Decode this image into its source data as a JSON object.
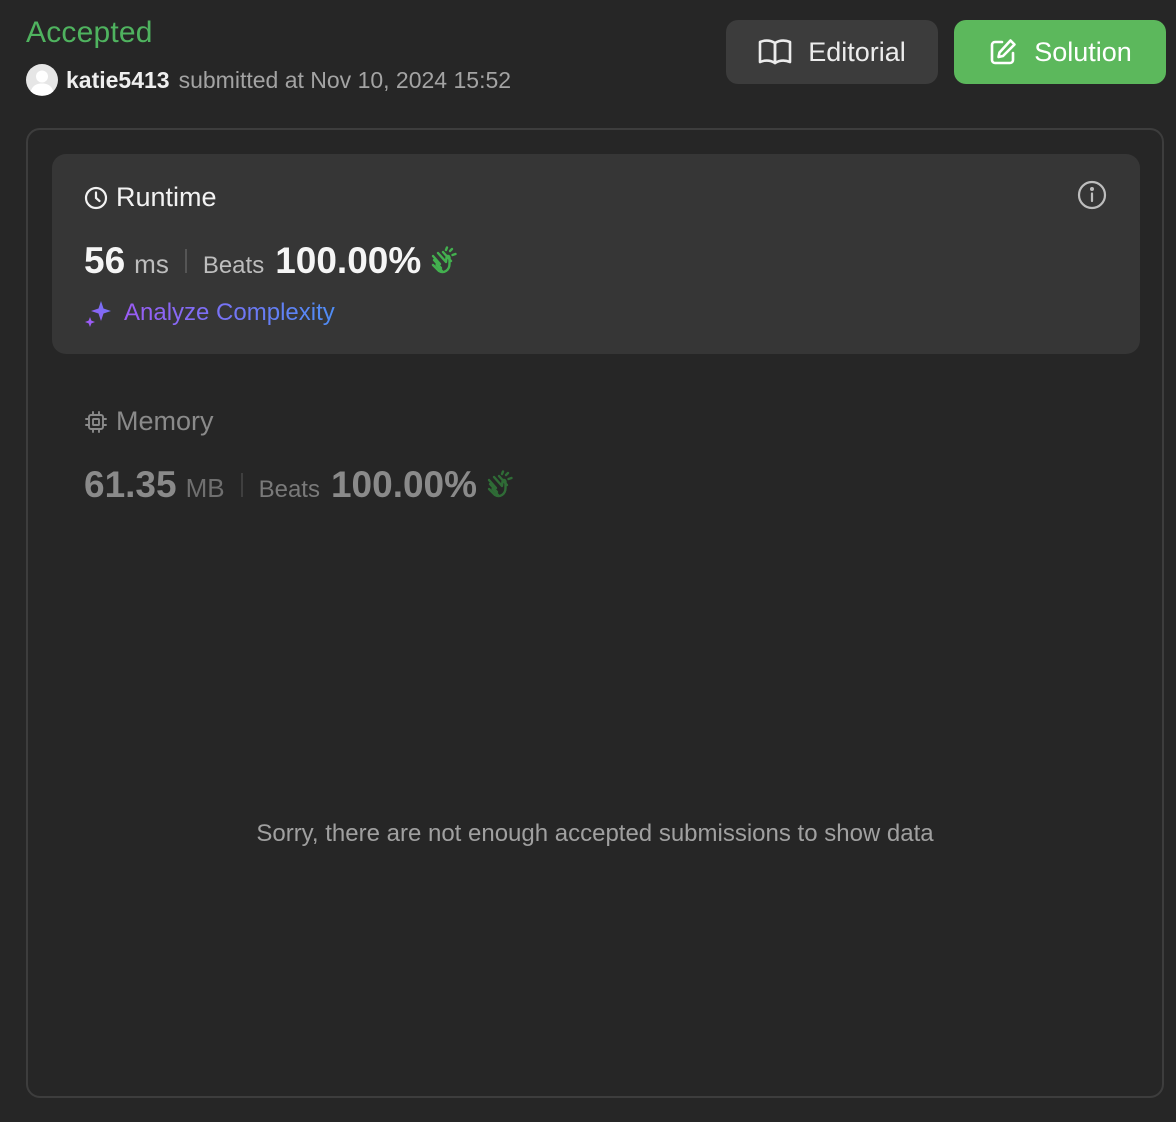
{
  "status": {
    "label": "Accepted",
    "color": "#4fb35f"
  },
  "submission": {
    "username": "katie5413",
    "submitted_text": "submitted at Nov 10, 2024 15:52"
  },
  "buttons": {
    "editorial": {
      "label": "Editorial",
      "icon": "book-open-icon"
    },
    "solution": {
      "label": "Solution",
      "icon": "edit-pencil-icon"
    }
  },
  "runtime": {
    "title": "Runtime",
    "icon": "clock-icon",
    "value": "56",
    "unit": "ms",
    "beats_label": "Beats",
    "beats_value": "100.00%",
    "badge_icon": "clapping-hands-icon",
    "analyze_label": "Analyze Complexity",
    "analyze_icon": "sparkles-icon",
    "info_icon": "info-icon"
  },
  "memory": {
    "title": "Memory",
    "icon": "chip-icon",
    "value": "61.35",
    "unit": "MB",
    "beats_label": "Beats",
    "beats_value": "100.00%",
    "badge_icon": "clapping-hands-icon"
  },
  "empty_state": {
    "message": "Sorry, there are not enough accepted submissions to show data"
  },
  "colors": {
    "background": "#262626",
    "accent_green": "#5cb85c",
    "card": "#363636",
    "analyze_gradient_start": "#9b5cf5",
    "analyze_gradient_end": "#4e8df5"
  }
}
